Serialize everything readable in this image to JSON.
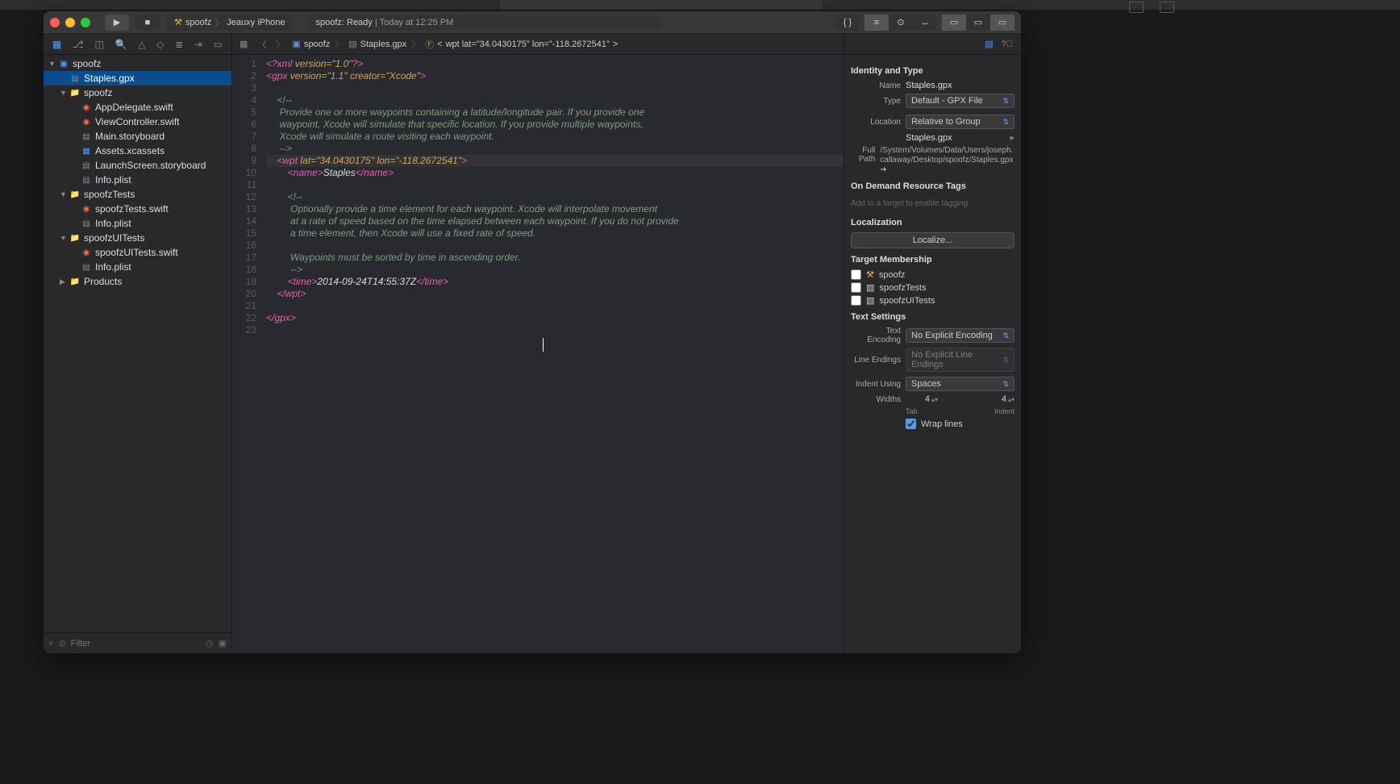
{
  "toolbar": {
    "scheme": "spoofz",
    "device": "Jeauxy iPhone",
    "status_app": "spoofz:",
    "status_state": "Ready",
    "status_sep": " | ",
    "status_time": "Today at 12:25 PM"
  },
  "navigator": {
    "filter_placeholder": "Filter"
  },
  "tree": [
    {
      "depth": 0,
      "disc": true,
      "icon": "proj",
      "label": "spoofz"
    },
    {
      "depth": 1,
      "disc": false,
      "icon": "gpx",
      "label": "Staples.gpx",
      "selected": true
    },
    {
      "depth": 1,
      "disc": true,
      "icon": "folder",
      "label": "spoofz"
    },
    {
      "depth": 2,
      "disc": false,
      "icon": "swift",
      "label": "AppDelegate.swift"
    },
    {
      "depth": 2,
      "disc": false,
      "icon": "swift",
      "label": "ViewController.swift"
    },
    {
      "depth": 2,
      "disc": false,
      "icon": "sb",
      "label": "Main.storyboard"
    },
    {
      "depth": 2,
      "disc": false,
      "icon": "asset",
      "label": "Assets.xcassets"
    },
    {
      "depth": 2,
      "disc": false,
      "icon": "sb",
      "label": "LaunchScreen.storyboard"
    },
    {
      "depth": 2,
      "disc": false,
      "icon": "plist",
      "label": "Info.plist"
    },
    {
      "depth": 1,
      "disc": true,
      "icon": "folder",
      "label": "spoofzTests"
    },
    {
      "depth": 2,
      "disc": false,
      "icon": "swift",
      "label": "spoofzTests.swift"
    },
    {
      "depth": 2,
      "disc": false,
      "icon": "plist",
      "label": "Info.plist"
    },
    {
      "depth": 1,
      "disc": true,
      "icon": "folder",
      "label": "spoofzUITests"
    },
    {
      "depth": 2,
      "disc": false,
      "icon": "swift",
      "label": "spoofzUITests.swift"
    },
    {
      "depth": 2,
      "disc": false,
      "icon": "plist",
      "label": "Info.plist"
    },
    {
      "depth": 1,
      "disc": true,
      "closed": true,
      "icon": "folder",
      "label": "Products"
    }
  ],
  "jumpbar": {
    "crumbs": [
      "spoofz",
      "Staples.gpx",
      "wpt lat=\"34.0430175\" lon=\"-118.2672541\""
    ]
  },
  "code": {
    "highlighted_line": 9,
    "lines": [
      {
        "n": 1,
        "html": "<span class='tag'>&lt;?xml</span> <span class='attr'>version=</span><span class='str'>\"1.0\"</span><span class='tag'>?&gt;</span>"
      },
      {
        "n": 2,
        "html": "<span class='tag'>&lt;gpx</span> <span class='attr'>version=</span><span class='str'>\"1.1\"</span> <span class='attr'>creator=</span><span class='str'>\"Xcode\"</span><span class='tag'>&gt;</span>"
      },
      {
        "n": 3,
        "html": ""
      },
      {
        "n": 4,
        "html": "    <span class='cmt'>&lt;!--</span>"
      },
      {
        "n": 5,
        "html": "     <span class='cmt'>Provide one or more waypoints containing a latitude/longitude pair. If you provide one</span>"
      },
      {
        "n": 6,
        "html": "     <span class='cmt'>waypoint, Xcode will simulate that specific location. If you provide multiple waypoints,</span>"
      },
      {
        "n": 7,
        "html": "     <span class='cmt'>Xcode will simulate a route visiting each waypoint.</span>"
      },
      {
        "n": 8,
        "html": "     <span class='cmt'>--&gt;</span>"
      },
      {
        "n": 9,
        "html": "    <span class='tag'>&lt;wpt</span> <span class='attr'>lat=</span><span class='str'>\"34.0430175\"</span> <span class='attr'>lon=</span><span class='str'>\"-118.2672541\"</span><span class='tag'>&gt;</span>"
      },
      {
        "n": 10,
        "html": "        <span class='tag'>&lt;name&gt;</span><span class='txt'>Staples</span><span class='tag'>&lt;/name&gt;</span>"
      },
      {
        "n": 11,
        "html": ""
      },
      {
        "n": 12,
        "html": "        <span class='cmt'>&lt;!--</span>"
      },
      {
        "n": 13,
        "html": "         <span class='cmt'>Optionally provide a time element for each waypoint. Xcode will interpolate movement</span>"
      },
      {
        "n": 14,
        "html": "         <span class='cmt'>at a rate of speed based on the time elapsed between each waypoint. If you do not provide</span>"
      },
      {
        "n": 15,
        "html": "         <span class='cmt'>a time element, then Xcode will use a fixed rate of speed.</span>"
      },
      {
        "n": 16,
        "html": ""
      },
      {
        "n": 17,
        "html": "         <span class='cmt'>Waypoints must be sorted by time in ascending order.</span>"
      },
      {
        "n": 18,
        "html": "         <span class='cmt'>--&gt;</span>"
      },
      {
        "n": 19,
        "html": "        <span class='tag'>&lt;time&gt;</span><span class='txt'>2014-09-24T14:55:37Z</span><span class='tag'>&lt;/time&gt;</span>"
      },
      {
        "n": 20,
        "html": "    <span class='tag'>&lt;/wpt&gt;</span>"
      },
      {
        "n": 21,
        "html": ""
      },
      {
        "n": 22,
        "html": "<span class='tag'>&lt;/gpx&gt;</span>"
      },
      {
        "n": 23,
        "html": ""
      }
    ]
  },
  "inspector": {
    "identity_title": "Identity and Type",
    "name_label": "Name",
    "name_value": "Staples.gpx",
    "type_label": "Type",
    "type_value": "Default - GPX File",
    "location_label": "Location",
    "location_value": "Relative to Group",
    "location_file": "Staples.gpx",
    "fullpath_label": "Full Path",
    "fullpath_value": "/System/Volumes/Data/Users/joseph.callaway/Desktop/spoofz/Staples.gpx",
    "tags_title": "On Demand Resource Tags",
    "tags_placeholder": "Add to a target to enable tagging",
    "loc_title": "Localization",
    "loc_button": "Localize...",
    "targets_title": "Target Membership",
    "targets": [
      "spoofz",
      "spoofzTests",
      "spoofzUITests"
    ],
    "text_title": "Text Settings",
    "enc_label": "Text Encoding",
    "enc_value": "No Explicit Encoding",
    "endings_label": "Line Endings",
    "endings_value": "No Explicit Line Endings",
    "indent_label": "Indent Using",
    "indent_value": "Spaces",
    "widths_label": "Widths",
    "tab_width": "4",
    "tab_label": "Tab",
    "indent_width": "4",
    "indent_width_label": "Indent",
    "wrap_label": "Wrap lines"
  }
}
